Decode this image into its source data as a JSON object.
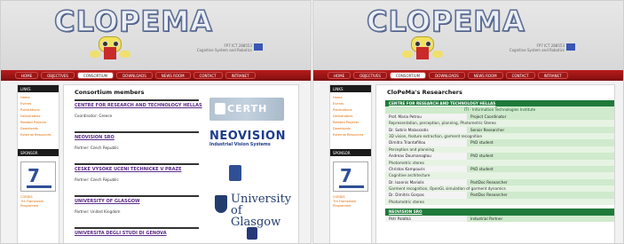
{
  "panels": [
    {
      "logo": "CLOPEMA",
      "nav": [
        "HOME",
        "OBJECTIVES",
        "CONSORTIUM",
        "DOWNLOADS",
        "NEWS ROOM",
        "CONTACT",
        "INTRANET"
      ],
      "nav_active": 2,
      "fp7_text": [
        "FP7 ICT 288553",
        "Cognitive System and Robotics"
      ],
      "sidebar": {
        "links_header": "LINKS",
        "links": [
          "Home",
          "Events",
          "Publications",
          "Deliverables",
          "Related Projects",
          "Downloads",
          "External Resources"
        ],
        "sponsor_header": "SPONSOR",
        "sponsor_caption": [
          "CORDIS",
          "7th Framework Programme"
        ]
      },
      "content": {
        "title": "Consortium members",
        "members": [
          {
            "name": "CENTRE FOR RESEARCH AND TECHNOLOGY HELLAS",
            "sub": "Coordinator: Greece",
            "logo": "CERTH"
          },
          {
            "name": "NEOVISION SRO",
            "sub": "Partner: Czech Republic",
            "logo": "NEOVISION",
            "logo_sub": "Industrial Vision Systems"
          },
          {
            "name": "CESKE VYSOKE UCENI TECHNICKE V PRAZE",
            "sub": "Partner: Czech Republic",
            "logo": "CTU"
          },
          {
            "name": "UNIVERSITY OF GLASGOW",
            "sub": "Partner: United Kingdom",
            "logo": "University of Glasgow"
          },
          {
            "name": "UNIVERSITA DEGLI STUDI DI GENOVA",
            "sub": "",
            "logo": ""
          }
        ]
      }
    },
    {
      "logo": "CLOPEMA",
      "nav": [
        "HOME",
        "OBJECTIVES",
        "CONSORTIUM",
        "DOWNLOADS",
        "NEWS ROOM",
        "CONTACT",
        "INTRANET"
      ],
      "nav_active": 2,
      "fp7_text": [
        "FP7 ICT 288553",
        "Cognitive System and Robotics"
      ],
      "sidebar": {
        "links_header": "LINKS",
        "links": [
          "Home",
          "Events",
          "Publications",
          "Deliverables",
          "Related Projects",
          "Downloads",
          "External Resources"
        ],
        "sponsor_header": "SPONSOR",
        "sponsor_caption": [
          "CORDIS",
          "7th Framework Programme"
        ]
      },
      "content": {
        "title": "CloPeMa's Researchers",
        "org1": "CENTRE FOR RESEARCH AND TECHNOLOGY HELLAS",
        "inst1": "ITI - Information Technologies Institute",
        "people1": [
          {
            "name": "Prof. Maria Petrou",
            "role": "Project Coordinator",
            "desc": "Representation, perception, planning, Photometric Stereo"
          },
          {
            "name": "Dr. Sotiris Malassiotis",
            "role": "Senior Researcher",
            "desc": "3D vision, feature extraction, garment recognition"
          },
          {
            "name": "Dimitra Triantafillou",
            "role": "PhD student",
            "desc": "Perception and planning"
          },
          {
            "name": "Andreas Doumanoglou",
            "role": "PhD student",
            "desc": "Photometric stereo"
          },
          {
            "name": "Christos Kampouris",
            "role": "PhD student",
            "desc": "Cognitive architecture"
          },
          {
            "name": "Dr. Ioannis Mariolis",
            "role": "PostDoc Researcher",
            "desc": "Garment recognition, OpenGL simulation of garment dynamics"
          },
          {
            "name": "Dr. Dimitris Gorpas",
            "role": "PostDoc Researcher",
            "desc": "Photometric stereo"
          }
        ],
        "org2": "NEOVISION SRO",
        "people2": [
          {
            "name": "Petr Palatka",
            "role": "Industrial Partner"
          }
        ]
      }
    }
  ]
}
